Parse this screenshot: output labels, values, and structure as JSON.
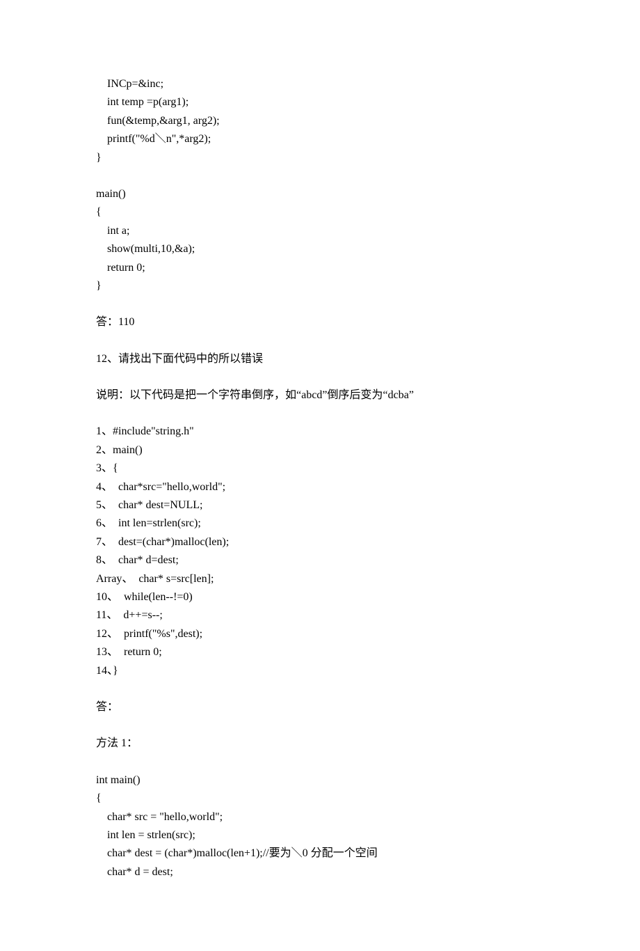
{
  "code1": {
    "l1": "    INCp=&inc;",
    "l2": "    int temp =p(arg1);",
    "l3": "    fun(&temp,&arg1, arg2);",
    "l4": "    printf(\"%d＼n\",*arg2);",
    "l5": "}"
  },
  "code2": {
    "l1": "main()",
    "l2": "{",
    "l3": "    int a;",
    "l4": "    show(multi,10,&a);",
    "l5": "    return 0;",
    "l6": "}"
  },
  "answer1": "答：110",
  "q12_title": "12、请找出下面代码中的所以错误",
  "q12_desc": "说明：以下代码是把一个字符串倒序，如“abcd”倒序后变为“dcba”",
  "code3": {
    "l1": "1、#include\"string.h\"",
    "l2": "2、main()",
    "l3": "3、{",
    "l4": "4、  char*src=\"hello,world\";",
    "l5": "5、  char* dest=NULL;",
    "l6": "6、  int len=strlen(src);",
    "l7": "7、  dest=(char*)malloc(len);",
    "l8": "8、  char* d=dest;",
    "l9": "Array、  char* s=src[len];",
    "l10": "10、  while(len--!=0)",
    "l11": "11、  d++=s--;",
    "l12": "12、  printf(\"%s\",dest);",
    "l13": "13、  return 0;",
    "l14": "14、}"
  },
  "answer2_label": "答：",
  "method1_label": "方法 1：",
  "code4": {
    "l1": "int main()",
    "l2": "{",
    "l3": "    char* src = \"hello,world\";",
    "l4": "    int len = strlen(src);",
    "l5": "    char* dest = (char*)malloc(len+1);//要为＼0 分配一个空间",
    "l6": "    char* d = dest;"
  }
}
